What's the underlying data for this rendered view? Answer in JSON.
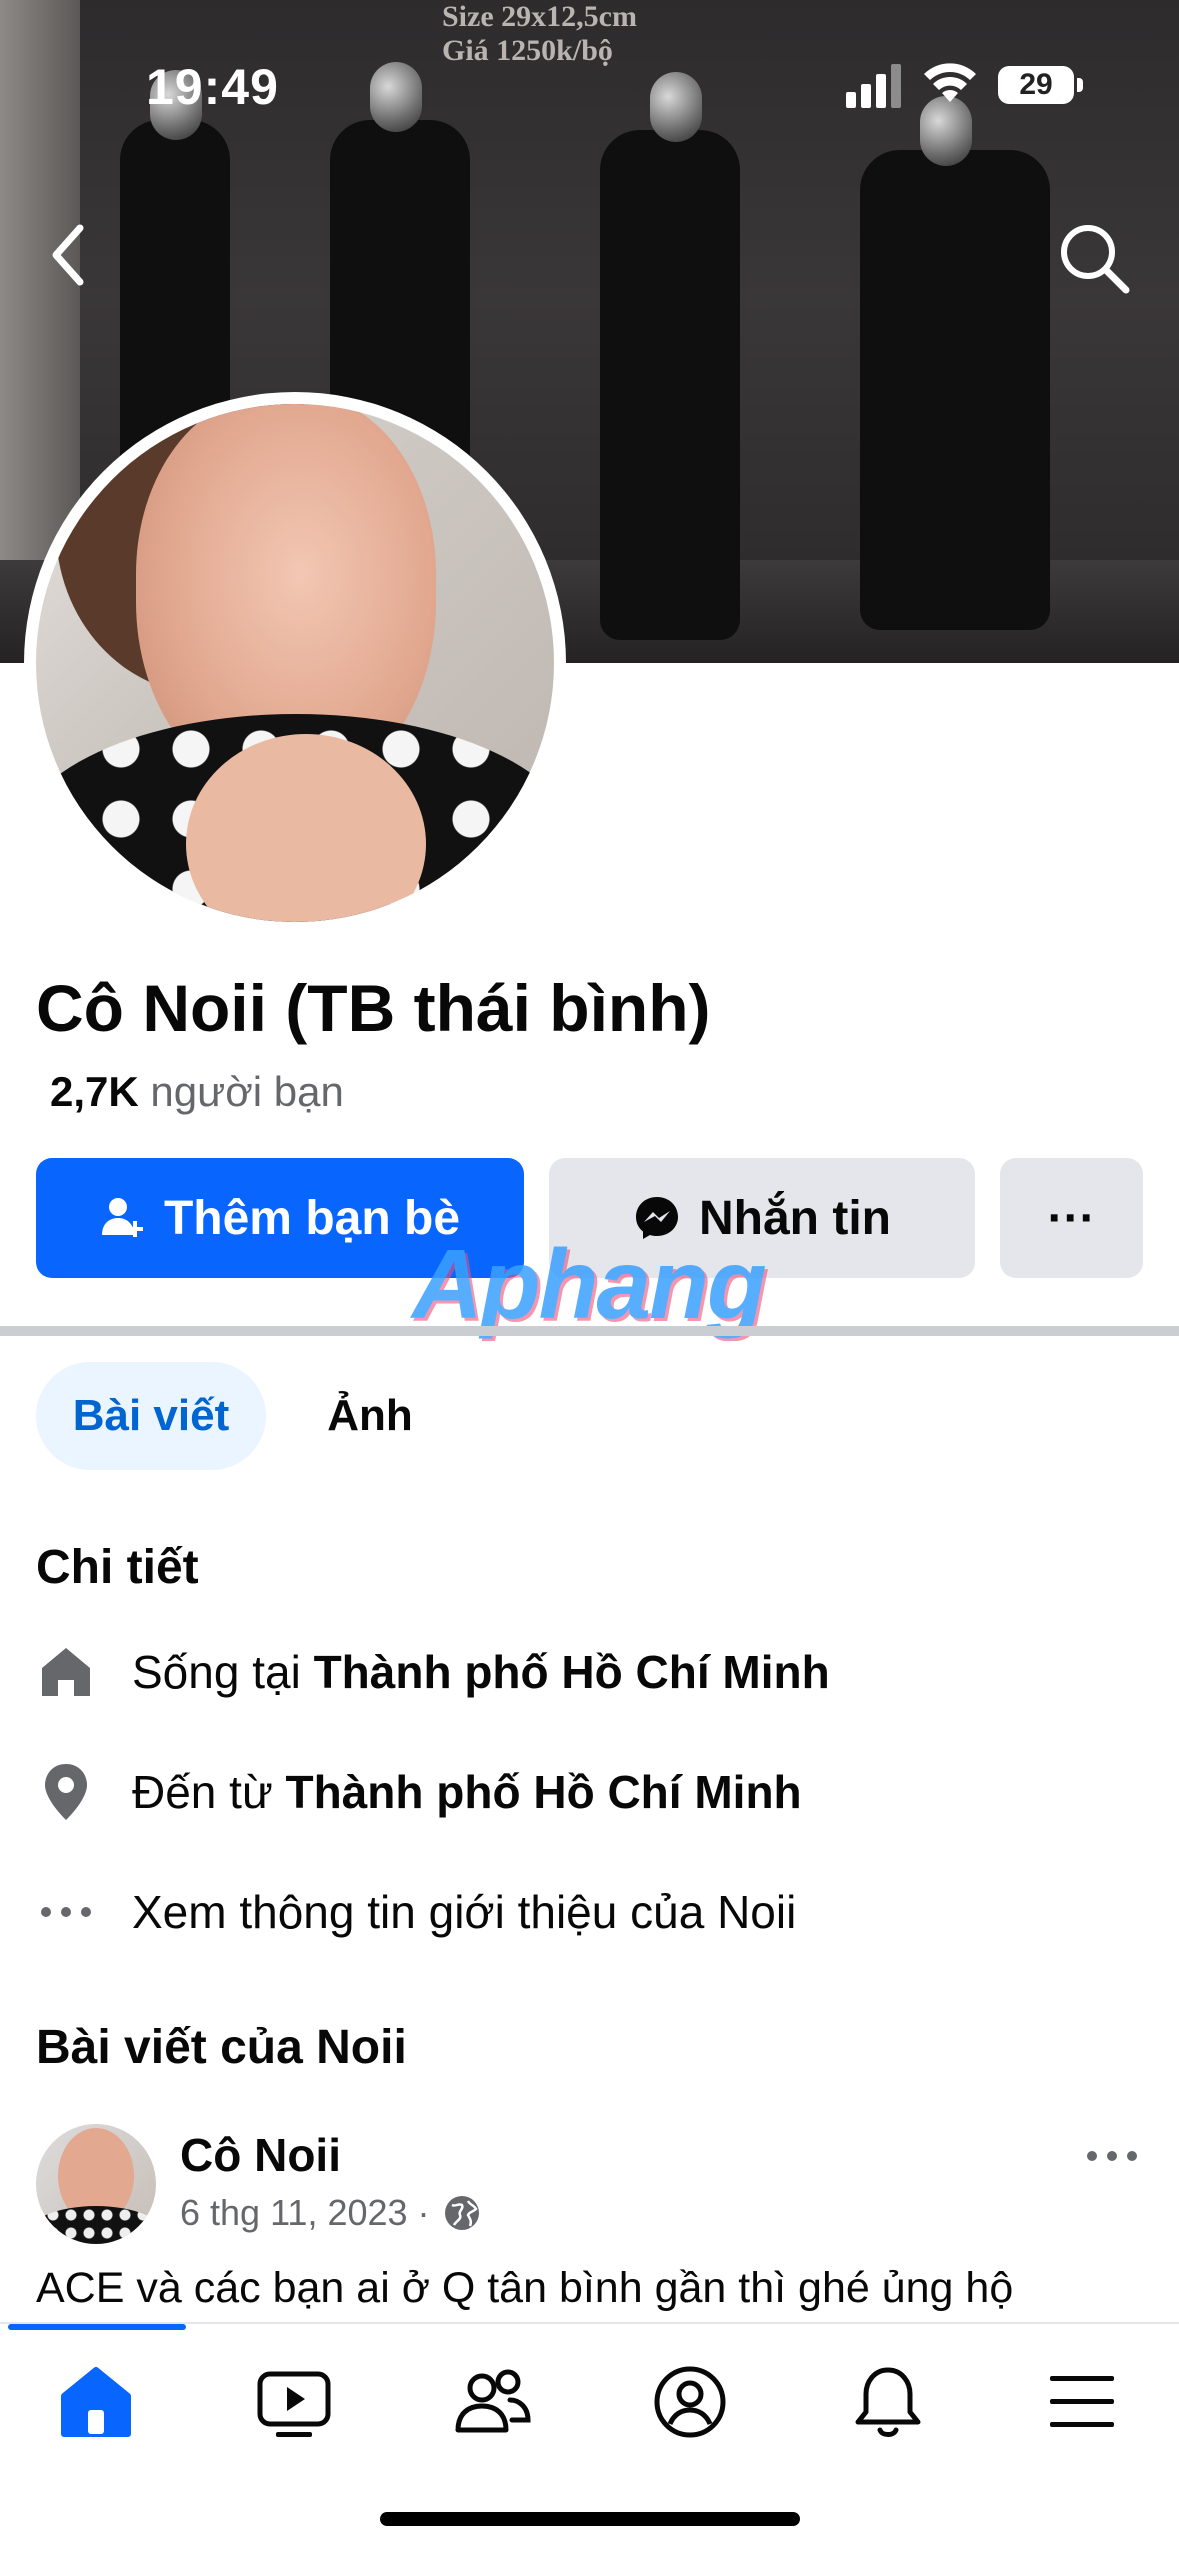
{
  "status_bar": {
    "time": "19:49",
    "battery": "29"
  },
  "cover": {
    "note_line1": "Size 29x12,5cm",
    "note_line2": "Giá 1250k/bộ"
  },
  "header": {
    "back_icon": "chevron-left-icon",
    "search_icon": "search-icon"
  },
  "profile": {
    "name": "Cô Noii (TB thái bình)",
    "friends_count": "2,7K",
    "friends_label": "người bạn"
  },
  "actions": {
    "add_friend_label": "Thêm bạn bè",
    "message_label": "Nhắn tin",
    "more_label": "···"
  },
  "watermark": "Aphang",
  "tabs": {
    "posts": "Bài viết",
    "photos": "Ảnh"
  },
  "details": {
    "title": "Chi tiết",
    "lives_in_prefix": "Sống tại ",
    "lives_in_value": "Thành phố Hồ Chí Minh",
    "from_prefix": "Đến từ ",
    "from_value": "Thành phố Hồ Chí Minh",
    "see_about": "Xem thông tin giới thiệu của Noii"
  },
  "posts_section": {
    "title": "Bài viết của Noii",
    "post": {
      "author": "Cô Noii",
      "date": "6 thg 11, 2023 ·",
      "text": "ACE và các bạn ai ở Q tân bình gần thì ghé ủng hộ"
    }
  },
  "colors": {
    "accent": "#0866ff",
    "tab_active_bg": "#ebf5ff",
    "secondary_text": "#65676b"
  }
}
